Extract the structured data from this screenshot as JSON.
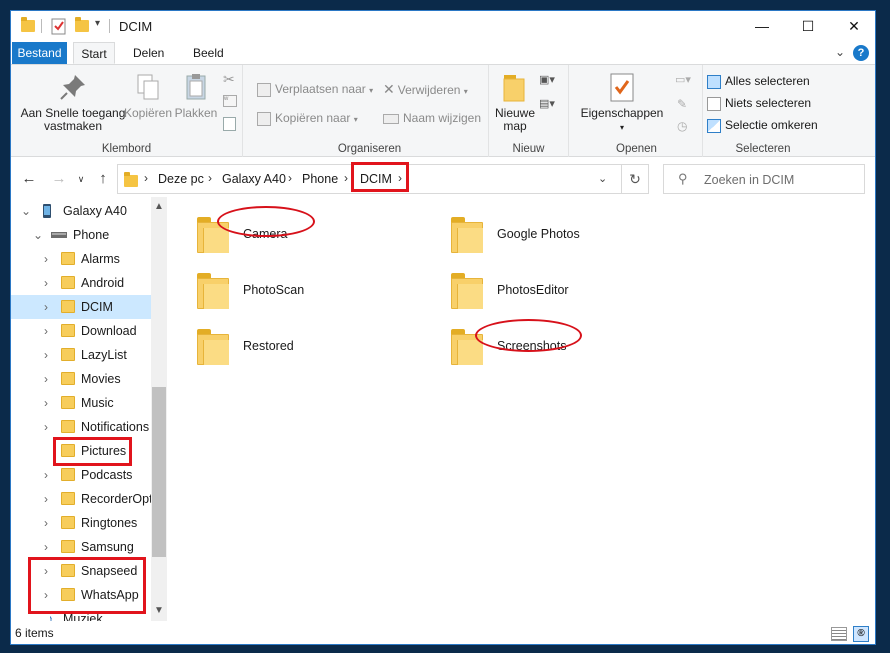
{
  "window": {
    "title": "DCIM",
    "controls": {
      "minimize": "—",
      "maximize": "☐",
      "close": "✕"
    }
  },
  "ribbon_tabs": {
    "file": "Bestand",
    "start": "Start",
    "share": "Delen",
    "view": "Beeld",
    "help": "?"
  },
  "ribbon": {
    "clipboard": {
      "pin_label_1": "Aan Snelle toegang",
      "pin_label_2": "vastmaken",
      "copy": "Kopiëren",
      "paste": "Plakken",
      "group": "Klembord"
    },
    "organize": {
      "move": "Verplaatsen naar",
      "copy_to": "Kopiëren naar",
      "delete": "Verwijderen",
      "rename": "Naam wijzigen",
      "group": "Organiseren"
    },
    "new": {
      "new_folder_1": "Nieuwe",
      "new_folder_2": "map",
      "group": "Nieuw"
    },
    "open": {
      "properties": "Eigenschappen",
      "group": "Openen"
    },
    "select": {
      "select_all": "Alles selecteren",
      "select_none": "Niets selecteren",
      "invert": "Selectie omkeren",
      "group": "Selecteren"
    }
  },
  "address": {
    "crumbs": [
      "Deze pc",
      "Galaxy A40",
      "Phone",
      "DCIM"
    ],
    "search_placeholder": "Zoeken in DCIM"
  },
  "nav_pane": {
    "device": "Galaxy A40",
    "phone": "Phone",
    "folders": [
      "Alarms",
      "Android",
      "DCIM",
      "Download",
      "LazyList",
      "Movies",
      "Music",
      "Notifications",
      "Pictures",
      "Podcasts",
      "RecorderOpti",
      "Ringtones",
      "Samsung",
      "Snapseed",
      "WhatsApp"
    ],
    "partial": "Muziek"
  },
  "content": {
    "folders": [
      "Camera",
      "Google Photos",
      "PhotoScan",
      "PhotosEditor",
      "Restored",
      "Screenshots"
    ]
  },
  "status": {
    "items": "6 items"
  },
  "colors": {
    "accent": "#1979ca",
    "selection": "#cce8ff",
    "annotation": "#e1141c"
  }
}
